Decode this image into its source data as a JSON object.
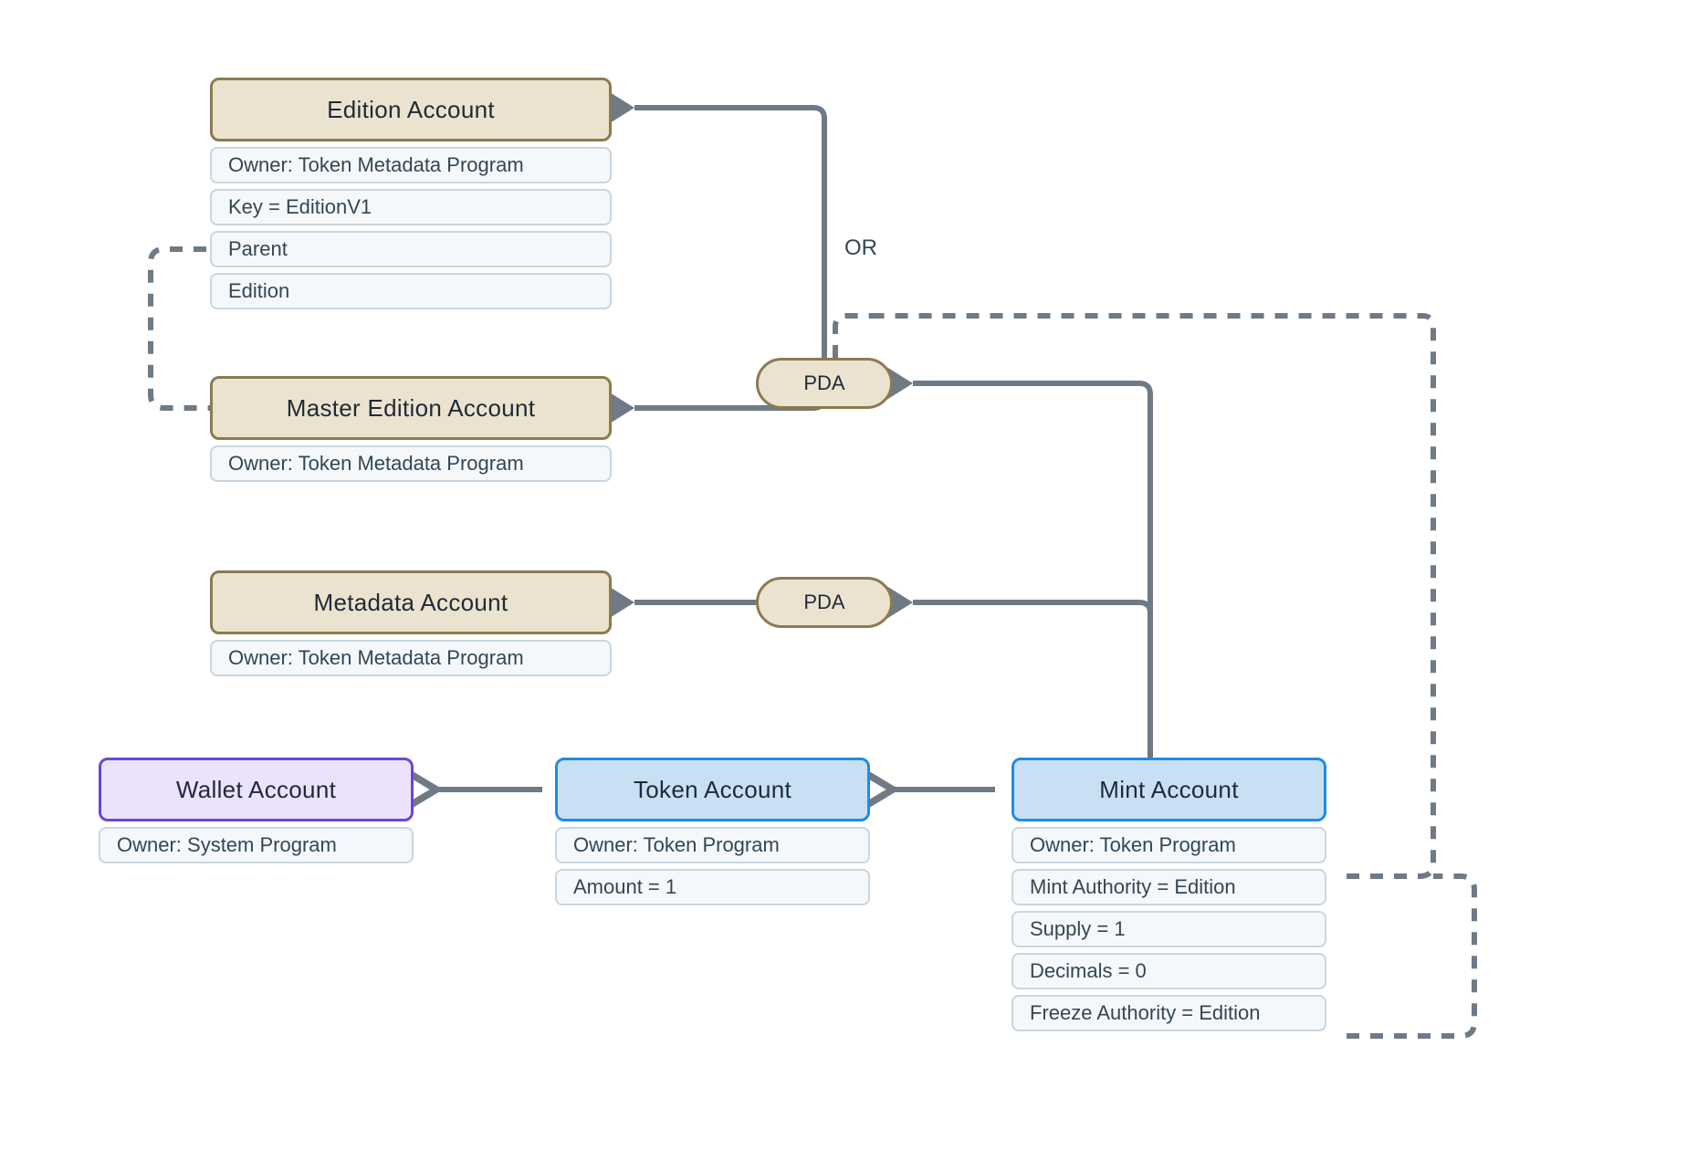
{
  "nodes": {
    "edition": {
      "title": "Edition Account",
      "fields": [
        "Owner: Token Metadata Program",
        "Key = EditionV1",
        "Parent",
        "Edition"
      ]
    },
    "master": {
      "title": "Master Edition Account",
      "fields": [
        "Owner: Token Metadata Program"
      ]
    },
    "metadata": {
      "title": "Metadata Account",
      "fields": [
        "Owner: Token Metadata Program"
      ]
    },
    "wallet": {
      "title": "Wallet Account",
      "fields": [
        "Owner: System Program"
      ]
    },
    "token": {
      "title": "Token Account",
      "fields": [
        "Owner: Token Program",
        "Amount = 1"
      ]
    },
    "mint": {
      "title": "Mint Account",
      "fields": [
        "Owner: Token Program",
        "Mint Authority = Edition",
        "Supply = 1",
        "Decimals = 0",
        "Freeze Authority = Edition"
      ]
    }
  },
  "pda_label": "PDA",
  "or_label": "OR"
}
